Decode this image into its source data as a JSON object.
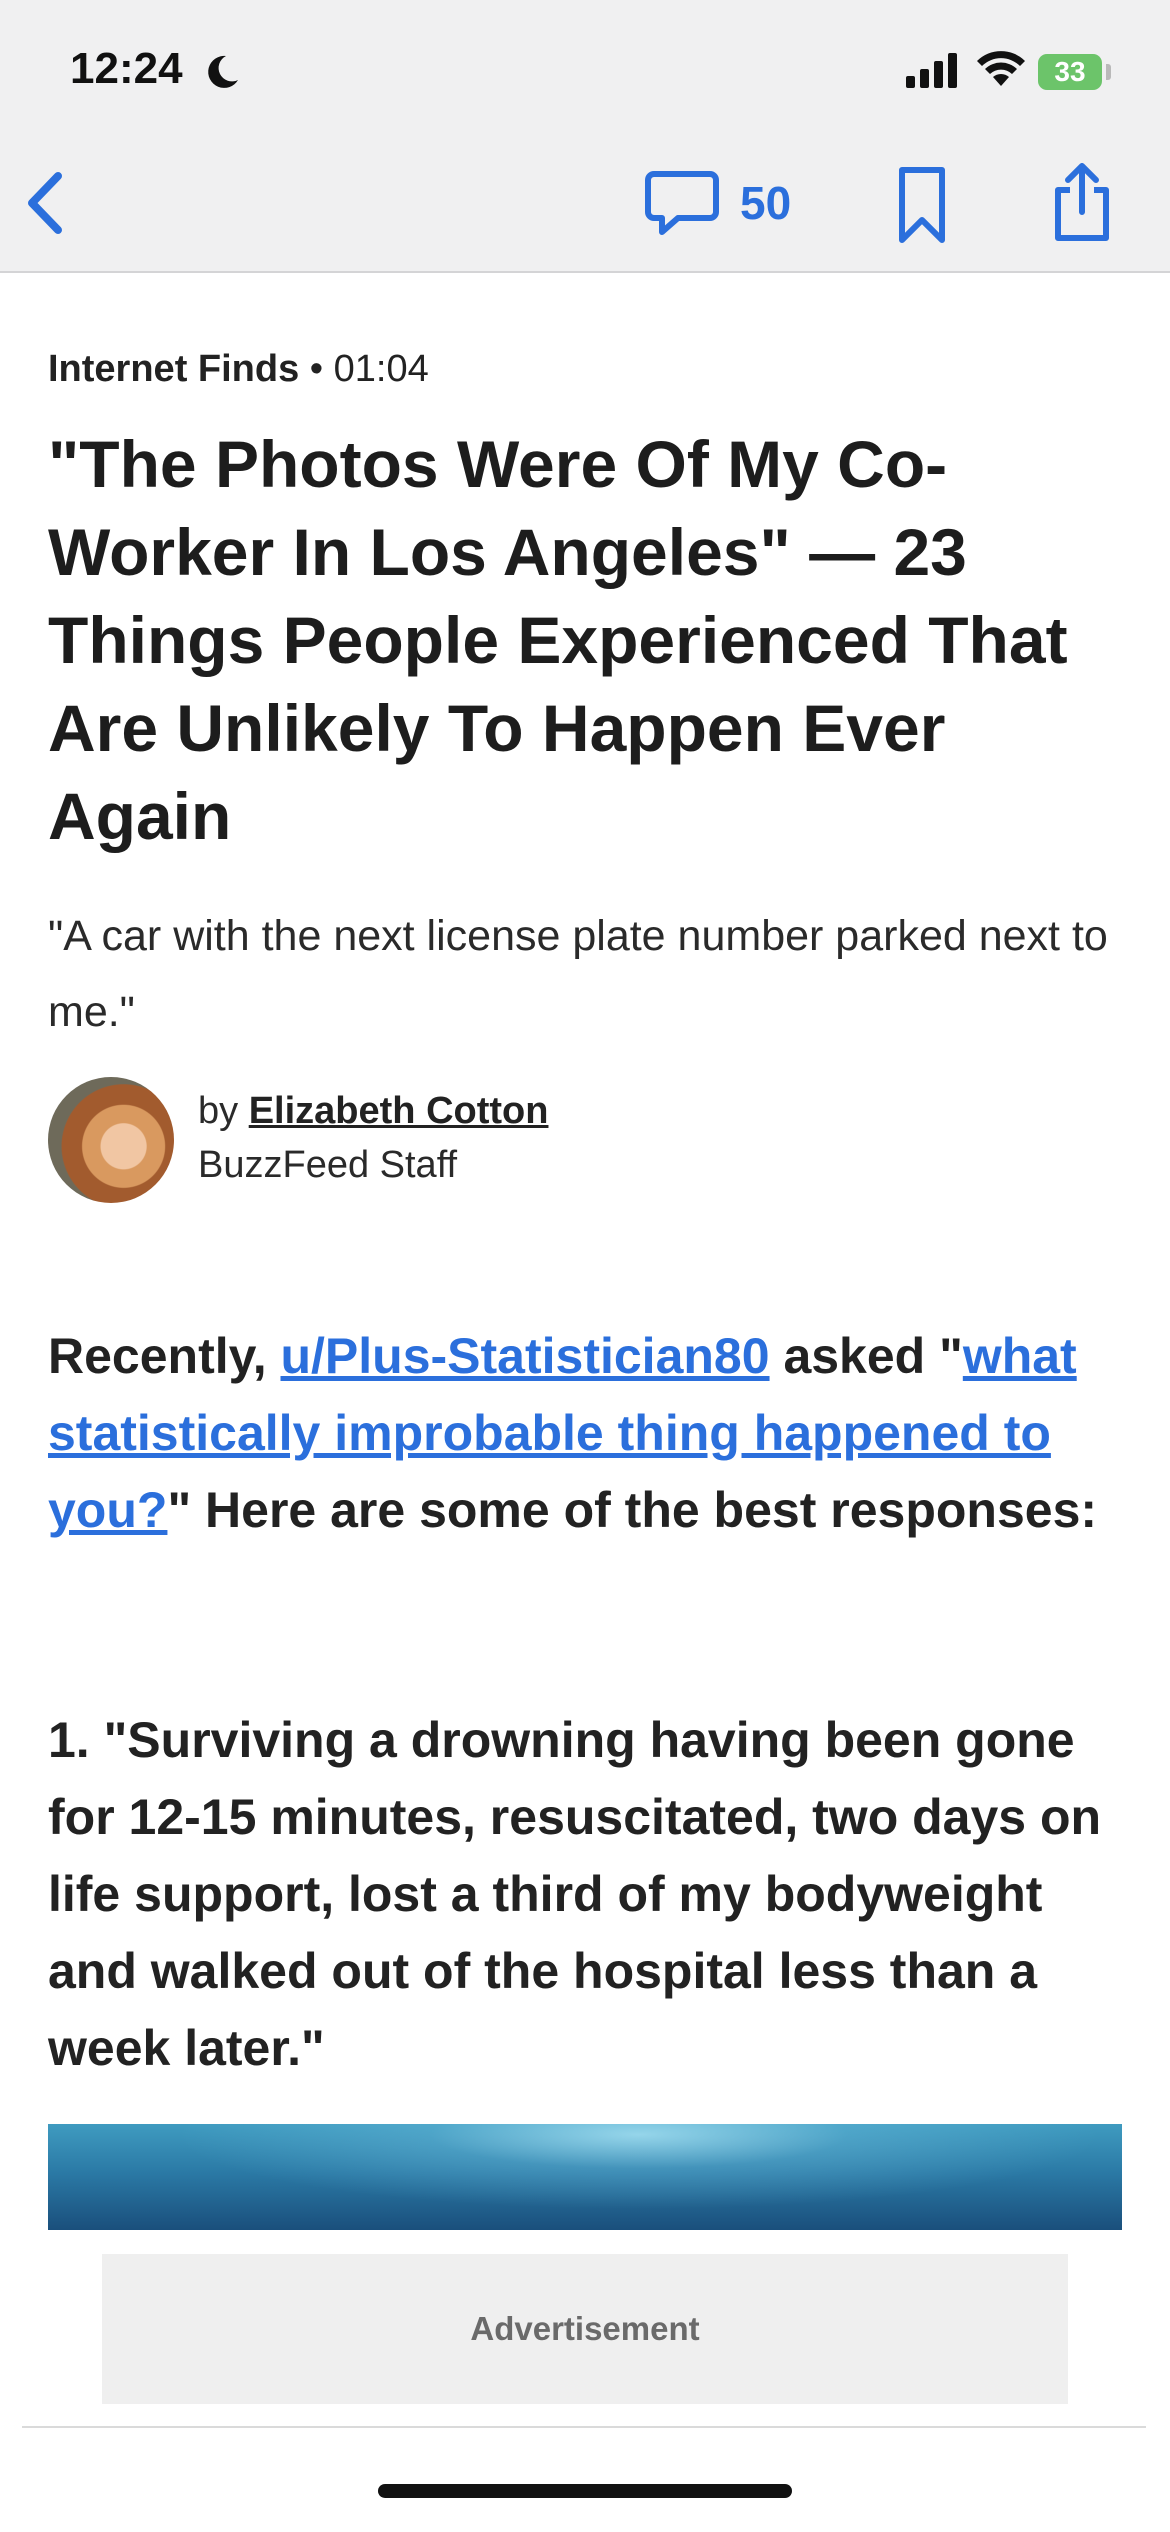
{
  "status_bar": {
    "time": "12:24",
    "battery": "33",
    "icons": [
      "moon-icon",
      "cellular-signal-icon",
      "wifi-icon",
      "battery-charging-icon"
    ]
  },
  "nav": {
    "comment_count": "50",
    "icons": [
      "back-chevron-icon",
      "comment-bubble-icon",
      "bookmark-icon",
      "share-icon"
    ],
    "accent_color": "#2b6fdc"
  },
  "article": {
    "category": "Internet Finds",
    "separator": " • ",
    "time": "01:04",
    "headline": "\"The Photos Were Of My Co-Worker In Los Angeles\" — 23 Things People Experienced That Are Unlikely To Happen Ever Again",
    "dek": "\"A car with the next license plate number parked next to me.\"",
    "byline_prefix": "by ",
    "author": "Elizabeth Cotton",
    "author_role": "BuzzFeed Staff"
  },
  "body": {
    "intro_start": "Recently, ",
    "user_link": "u/Plus-Statistician80",
    "intro_mid": " asked \"",
    "question_link": "what statistically improbable thing happened to you?",
    "intro_end": "\" Here are some of the best responses:",
    "item1": "1. \"Surviving a drowning having been gone for 12-15 minutes, resuscitated, two days on life support, lost a third of my bodyweight and walked out of the hospital less than a week later.\""
  },
  "ad": {
    "label": "Advertisement"
  }
}
